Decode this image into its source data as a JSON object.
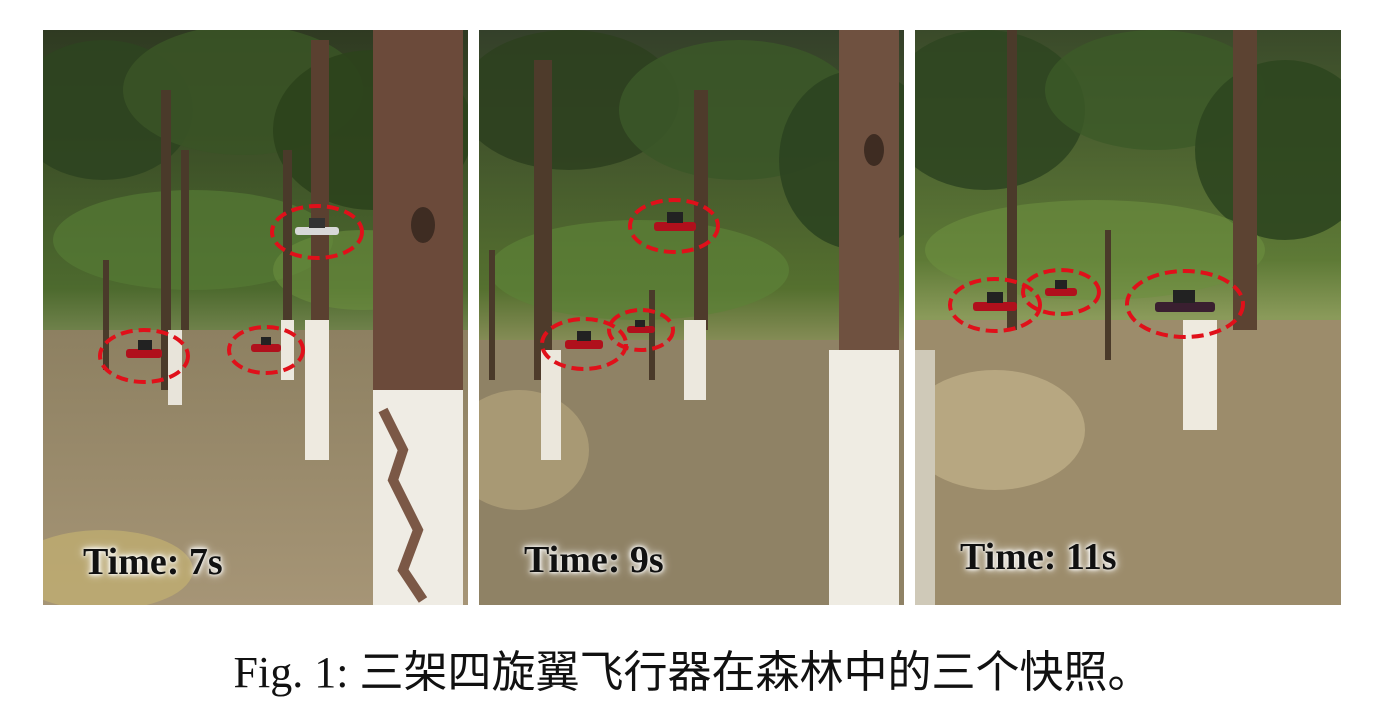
{
  "figure": {
    "caption": "Fig. 1: 三架四旋翼飞行器在森林中的三个快照。",
    "panels": [
      {
        "time_label": "Time: 7s"
      },
      {
        "time_label": "Time: 9s"
      },
      {
        "time_label": "Time: 11s"
      }
    ],
    "colors": {
      "highlight_ellipse": "#e0101a",
      "drone_body": "#b0101c",
      "trunk_whitewash": "#f2f0ea"
    }
  }
}
